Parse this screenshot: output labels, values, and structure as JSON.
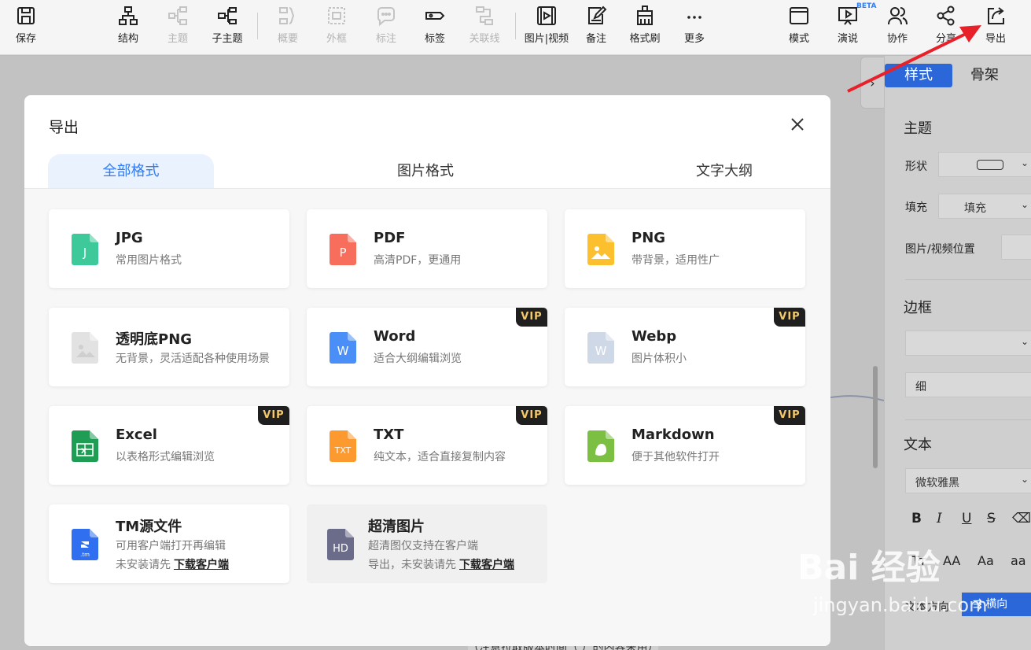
{
  "toolbar": {
    "save": "保存",
    "structure": "结构",
    "topic": "主题",
    "subtopic": "子主题",
    "summary": "概要",
    "frame": "外框",
    "callout": "标注",
    "tag": "标签",
    "relation": "关联线",
    "media": "图片|视频",
    "note": "备注",
    "format_painter": "格式刷",
    "more": "更多",
    "mode": "模式",
    "present": "演说",
    "beta": "BETA",
    "collab": "协作",
    "share": "分享",
    "export": "导出"
  },
  "side_panel": {
    "tab_style": "样式",
    "tab_skeleton": "骨架",
    "section_topic": "主题",
    "shape_label": "形状",
    "fill_label": "填充",
    "fill_value": "填充",
    "media_pos_label": "图片/视频位置",
    "section_border": "边框",
    "border_width": "细",
    "section_text": "文本",
    "font_value": "微软雅黑",
    "text_dir_label": "文本方向",
    "text_dir_value": "横向",
    "case_options": [
      "Tт",
      "AA",
      "Aa",
      "aa"
    ]
  },
  "dialog": {
    "title": "导出",
    "tabs": [
      "全部格式",
      "图片格式",
      "文字大纲"
    ],
    "active_tab": "全部格式",
    "vip_label": "VIP",
    "download_link": "下载客户端",
    "cards": [
      {
        "title": "JPG",
        "desc": "常用图片格式",
        "icon": "jpg-file-icon",
        "glyph": "J",
        "color": "#3ec99a",
        "vip": false
      },
      {
        "title": "PDF",
        "desc": "高清PDF，更通用",
        "icon": "pdf-file-icon",
        "glyph": "P",
        "color": "#f76e5c",
        "vip": false
      },
      {
        "title": "PNG",
        "desc": "带背景，适用性广",
        "icon": "png-file-icon",
        "glyph": "",
        "color": "#fcc02e",
        "vip": false
      },
      {
        "title": "透明底PNG",
        "desc": "无背景，灵活适配各种使用场景",
        "icon": "transparent-png-file-icon",
        "glyph": "",
        "color": "#e2e2e2",
        "vip": false
      },
      {
        "title": "Word",
        "desc": "适合大纲编辑浏览",
        "icon": "word-file-icon",
        "glyph": "W",
        "color": "#4a8ff7",
        "vip": true
      },
      {
        "title": "Webp",
        "desc": "图片体积小",
        "icon": "webp-file-icon",
        "glyph": "W",
        "color": "#cfd8e6",
        "vip": true
      },
      {
        "title": "Excel",
        "desc": "以表格形式编辑浏览",
        "icon": "excel-file-icon",
        "glyph": "X",
        "color": "#1f9d55",
        "vip": true
      },
      {
        "title": "TXT",
        "desc": "纯文本，适合直接复制内容",
        "icon": "txt-file-icon",
        "glyph": "TXT",
        "color": "#fd9a2f",
        "vip": true
      },
      {
        "title": "Markdown",
        "desc": "便于其他软件打开",
        "icon": "markdown-file-icon",
        "glyph": "",
        "color": "#7bc043",
        "vip": true
      },
      {
        "title": "TM源文件",
        "desc": "可用客户端打开再编辑",
        "desc2": "未安装请先",
        "icon": "tm-file-icon",
        "glyph": ".tm",
        "color": "#2f6ff0",
        "vip": false
      },
      {
        "title": "超清图片",
        "desc": "超清图仅支持在客户端",
        "desc2": "导出，未安装请先",
        "icon": "hd-file-icon",
        "glyph": "HD",
        "color": "#6b6b8a",
        "vip": false
      }
    ]
  },
  "watermark": {
    "big": "Bai 经验",
    "small": "jingyan.baidu.com"
  },
  "canvas_text": "（注意拉取版本时间（   ）的内容来用）"
}
